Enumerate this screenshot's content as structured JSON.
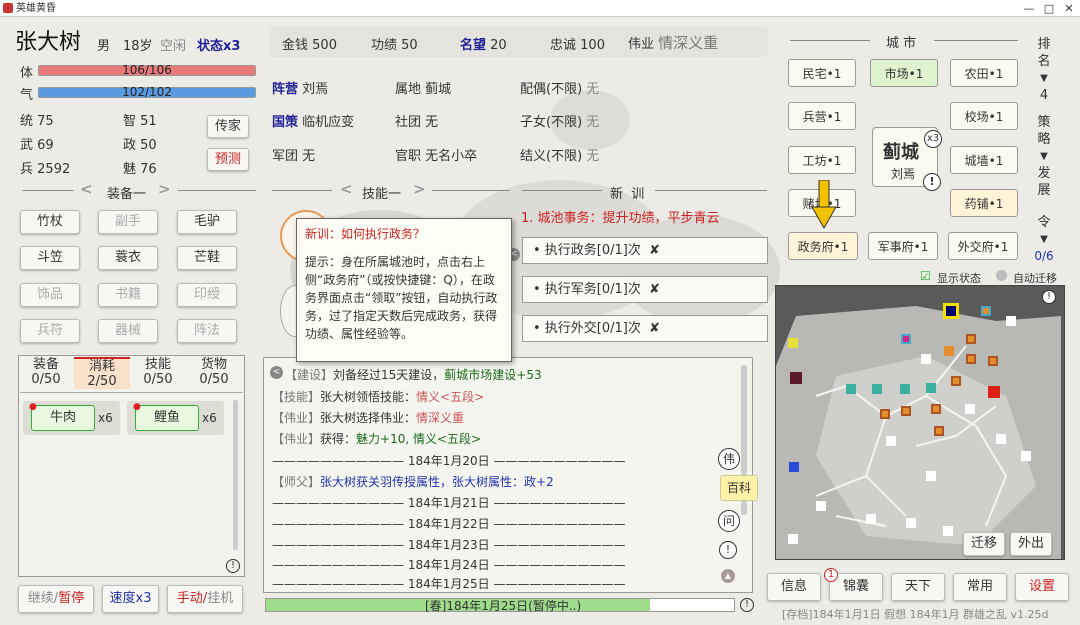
{
  "window": {
    "title": "英雄黄昏"
  },
  "character": {
    "name": "张大树",
    "gender": "男",
    "age": "18岁",
    "status": "空闲",
    "state": "状态x3",
    "hp_label": "体",
    "hp_text": "106/106",
    "hp_fraction": 1.0,
    "qi_label": "气",
    "qi_text": "102/102",
    "qi_fraction": 1.0,
    "attrs": [
      {
        "k": "统",
        "v": "75"
      },
      {
        "k": "智",
        "v": "51"
      },
      {
        "k": "武",
        "v": "69"
      },
      {
        "k": "政",
        "v": "50"
      },
      {
        "k": "兵",
        "v": "2592"
      },
      {
        "k": "魅",
        "v": "76"
      }
    ],
    "chuanjia": "传家",
    "yuce": "预测"
  },
  "equipment": {
    "title": "装备一",
    "slots": [
      "竹杖",
      "副手",
      "毛驴",
      "斗笠",
      "蓑衣",
      "芒鞋",
      "饰品",
      "书籍",
      "印绶",
      "兵符",
      "器械",
      "阵法"
    ]
  },
  "inventory": {
    "tabs": [
      {
        "label": "装备",
        "count": "0/50"
      },
      {
        "label": "消耗",
        "count": "2/50"
      },
      {
        "label": "技能",
        "count": "0/50"
      },
      {
        "label": "货物",
        "count": "0/50"
      }
    ],
    "items": [
      {
        "name": "牛肉",
        "qty": "x6"
      },
      {
        "name": "鲤鱼",
        "qty": "x6"
      }
    ]
  },
  "controls": {
    "pause": "继续/暂停",
    "speed": "速度x3",
    "mode": "手动/挂机"
  },
  "topstats": [
    {
      "k": "金钱",
      "v": "500"
    },
    {
      "k": "功绩",
      "v": "50"
    },
    {
      "k": "名望",
      "v": "20"
    },
    {
      "k": "忠诚",
      "v": "100"
    },
    {
      "k": "伟业",
      "v": "情深义重"
    }
  ],
  "info": {
    "zhenying_k": "阵营",
    "zhenying_v": "刘焉",
    "shudi_k": "属地",
    "shudi_v": "蓟城",
    "peiou_k": "配偶(不限)",
    "peiou_v": "无",
    "guoce_k": "国策",
    "guoce_v": "临机应变",
    "shetuan_k": "社团",
    "shetuan_v": "无",
    "zinv_k": "子女(不限)",
    "zinv_v": "无",
    "juntuan_k": "军团",
    "juntuan_v": "无",
    "guanzhi_k": "官职",
    "guanzhi_v": "无名小卒",
    "jieyi_k": "结义(不限)",
    "jieyi_v": "无"
  },
  "skills": {
    "title": "技能一"
  },
  "xinxun": {
    "title": "新  训",
    "task_title": "1. 城池事务：提升功绩，平步青云",
    "tasks": [
      "• 执行政务[0/1]次",
      "• 执行军务[0/1]次",
      "• 执行外交[0/1]次"
    ],
    "mark": "✘"
  },
  "tooltip": {
    "title": "新训：如何执行政务？",
    "body": "提示：身在所属城池时，点击右上侧“政务府”（或按快捷键：Q），在政务界面点击“领取”按钮，自动执行政务，过了指定天数后完成政务，获得功绩、属性经验等。"
  },
  "log": [
    {
      "tag": "【建设】",
      "text": "刘备经过15天建设，",
      "hl": "蓟城市场建设+53",
      "hlc": "green"
    },
    {
      "tag": "【技能】",
      "text": "张大树领悟技能：",
      "hl": "情义<五段>",
      "hlc": "orange"
    },
    {
      "tag": "【伟业】",
      "text": "张大树选择伟业：",
      "hl": "情深义重",
      "hlc": "orange"
    },
    {
      "tag": "【伟业】",
      "text": "获得：",
      "hl": "魅力+10, 情义<五段>",
      "hlc": "green"
    },
    {
      "tag": "",
      "date": "184年1月20日"
    },
    {
      "tag": "【师父】",
      "text": "张大树获关羽传授属性，张大树属性：政+2",
      "hl": "",
      "hlc": "blue"
    },
    {
      "tag": "",
      "date": "184年1月21日"
    },
    {
      "tag": "",
      "date": "184年1月22日"
    },
    {
      "tag": "",
      "date": "184年1月23日"
    },
    {
      "tag": "",
      "date": "184年1月24日"
    },
    {
      "tag": "",
      "date": "184年1月25日"
    }
  ],
  "side_icons": {
    "wei": "伟",
    "baike": "百科",
    "wen": "问",
    "bang": "!"
  },
  "progress": {
    "text": "[春]184年1月25日(暂停中..)",
    "fraction": 0.82
  },
  "city": {
    "title": "城 市",
    "name": "蓟城",
    "ruler": "刘焉",
    "count": "x3",
    "buildings": [
      "民宅•1",
      "市场•1",
      "农田•1",
      "兵营•1",
      "校场•1",
      "工坊•1",
      "城墙•1",
      "赌坊•1",
      "药铺•1",
      "政务府•1",
      "军事府•1",
      "外交府•1"
    ],
    "show_state": "显示状态",
    "auto_move": "自动迁移"
  },
  "rank": {
    "label1": "排名",
    "rank": "4",
    "label2": "策略",
    "label3": "发展",
    "label4": "令",
    "ling": "0/6"
  },
  "map": {
    "move": "迁移",
    "out": "外出"
  },
  "bottom": {
    "info": "信息",
    "jinnang": "锦囊",
    "jinnang_badge": "1",
    "tianxia": "天下",
    "changyong": "常用",
    "shezhi": "设置",
    "footer": "[存档]184年1月1日 假想  184年1月 群雄之乱 v1.25d"
  },
  "colors": {
    "hp": "#e87a7a",
    "qi": "#5a9ae0",
    "accent_blue": "#22229a",
    "arrow": "#f2c200"
  }
}
